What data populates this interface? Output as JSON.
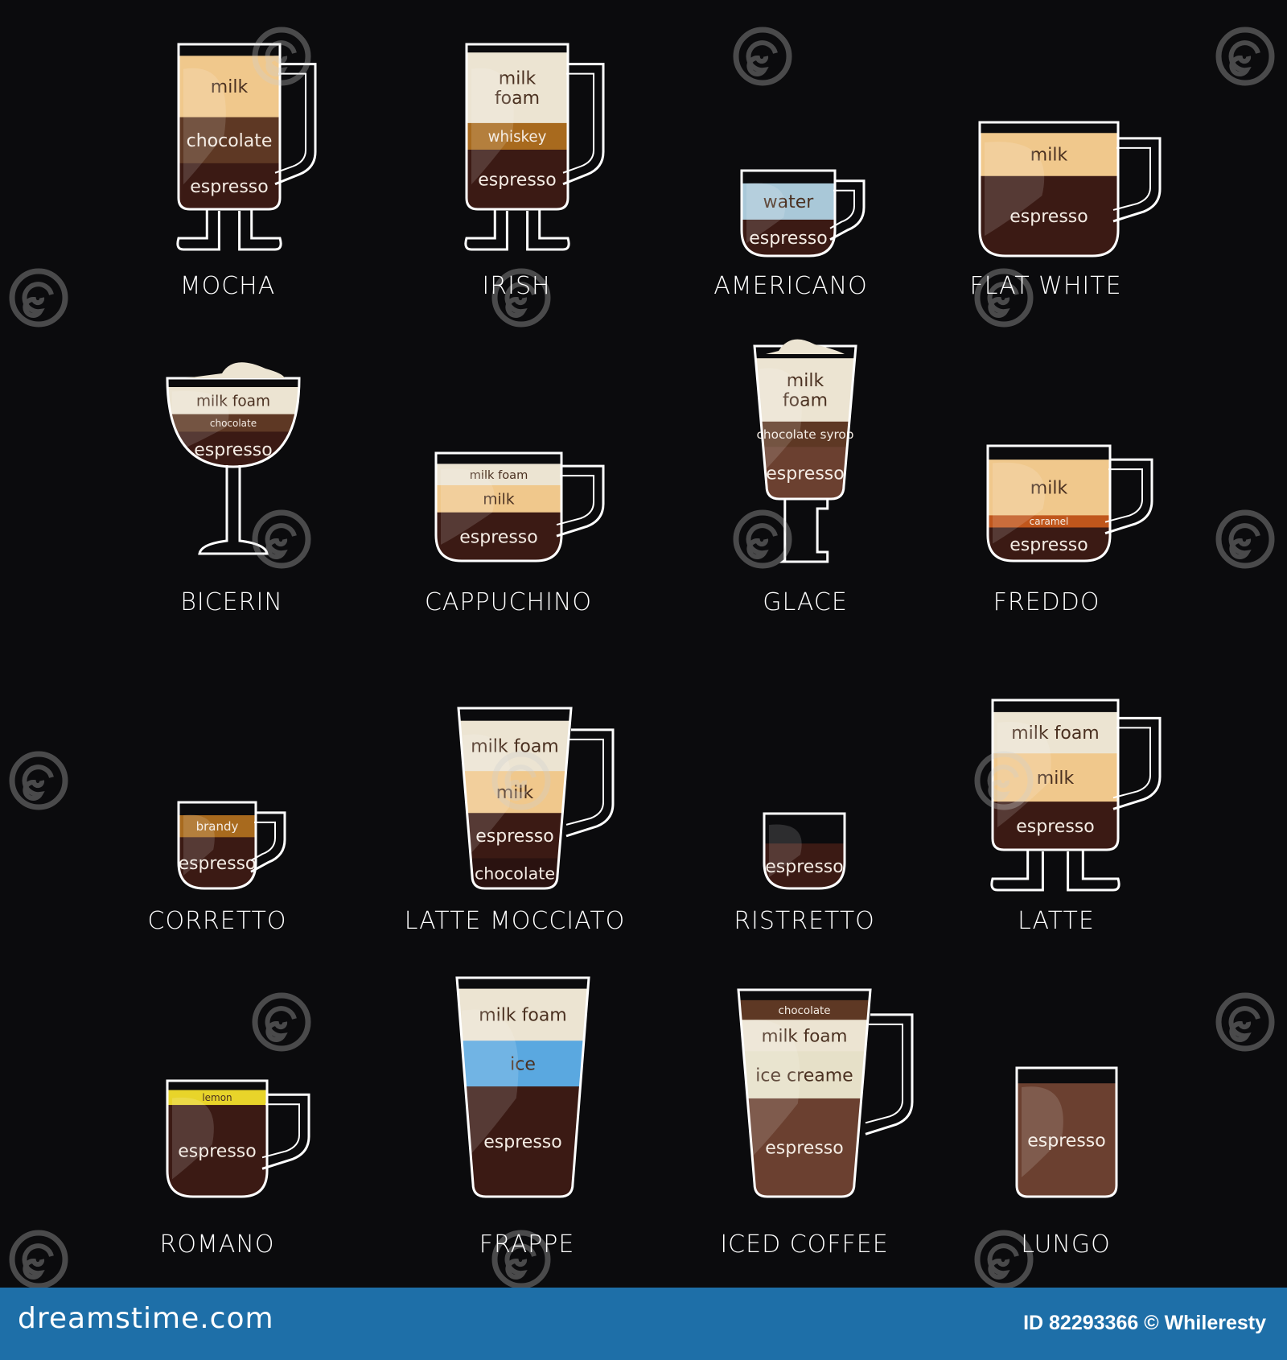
{
  "drinks": [
    {
      "name": "MOCHA",
      "layers": [
        {
          "label": "milk",
          "color": "#f0c88c"
        },
        {
          "label": "chocolate",
          "color": "#5e3824"
        },
        {
          "label": "espresso",
          "color": "#3b1a14"
        }
      ]
    },
    {
      "name": "IRISH",
      "layers": [
        {
          "label": "milk foam",
          "color": "#ece4d2"
        },
        {
          "label": "whiskey",
          "color": "#a86a1e"
        },
        {
          "label": "espresso",
          "color": "#3b1a14"
        }
      ]
    },
    {
      "name": "AMERICANO",
      "layers": [
        {
          "label": "water",
          "color": "#a9c8d8"
        },
        {
          "label": "espresso",
          "color": "#3b1a14"
        }
      ]
    },
    {
      "name": "FLAT WHITE",
      "layers": [
        {
          "label": "milk",
          "color": "#f0c88c"
        },
        {
          "label": "espresso",
          "color": "#3b1a14"
        }
      ]
    },
    {
      "name": "BICERIN",
      "layers": [
        {
          "label": "milk foam",
          "color": "#ece4d2"
        },
        {
          "label": "chocolate",
          "color": "#5e3824"
        },
        {
          "label": "espresso",
          "color": "#3b1a14"
        }
      ]
    },
    {
      "name": "CAPPUCHINO",
      "layers": [
        {
          "label": "milk foam",
          "color": "#ece4d2"
        },
        {
          "label": "milk",
          "color": "#f0c88c"
        },
        {
          "label": "espresso",
          "color": "#3b1a14"
        }
      ]
    },
    {
      "name": "GLACE",
      "layers": [
        {
          "label": "milk foam",
          "color": "#ece4d2"
        },
        {
          "label": "chocolate syrop",
          "color": "#5e3824"
        },
        {
          "label": "espresso",
          "color": "#6b4030"
        }
      ]
    },
    {
      "name": "FREDDO",
      "layers": [
        {
          "label": "milk",
          "color": "#f0c88c"
        },
        {
          "label": "caramel",
          "color": "#c0561c"
        },
        {
          "label": "espresso",
          "color": "#3b1a14"
        }
      ]
    },
    {
      "name": "CORRETTO",
      "layers": [
        {
          "label": "brandy",
          "color": "#a86a1e"
        },
        {
          "label": "espresso",
          "color": "#3b1a14"
        }
      ]
    },
    {
      "name": "LATTE MOCCIATO",
      "layers": [
        {
          "label": "milk foam",
          "color": "#ece4d2"
        },
        {
          "label": "milk",
          "color": "#f0c88c"
        },
        {
          "label": "espresso",
          "color": "#3b1a14"
        },
        {
          "label": "chocolate",
          "color": "#2a1210"
        }
      ]
    },
    {
      "name": "RISTRETTO",
      "layers": [
        {
          "label": "espresso",
          "color": "#3b1a14"
        }
      ]
    },
    {
      "name": "LATTE",
      "layers": [
        {
          "label": "milk foam",
          "color": "#ece4d2"
        },
        {
          "label": "milk",
          "color": "#f0c88c"
        },
        {
          "label": "espresso",
          "color": "#3b1a14"
        }
      ]
    },
    {
      "name": "ROMANO",
      "layers": [
        {
          "label": "lemon",
          "color": "#e8d42a"
        },
        {
          "label": "espresso",
          "color": "#3b1a14"
        }
      ]
    },
    {
      "name": "FRAPPE",
      "layers": [
        {
          "label": "milk foam",
          "color": "#ece4d2"
        },
        {
          "label": "ice",
          "color": "#5aa8e0"
        },
        {
          "label": "espresso",
          "color": "#3b1a14"
        }
      ]
    },
    {
      "name": "ICED COFFEE",
      "layers": [
        {
          "label": "chocolate",
          "color": "#5e3824"
        },
        {
          "label": "milk foam",
          "color": "#ece4d2"
        },
        {
          "label": "ice creame",
          "color": "#e6e0c8"
        },
        {
          "label": "espresso",
          "color": "#6b4030"
        }
      ]
    },
    {
      "name": "LUNGO",
      "layers": [
        {
          "label": "espresso",
          "color": "#6b4030"
        }
      ]
    }
  ],
  "watermark": {
    "text": "dreamstime"
  },
  "footer": {
    "brand": "dreamstime.com",
    "credit": "ID 82293366 © Whileresty"
  },
  "colors": {
    "background": "#0b0b0d",
    "outline": "#ffffff",
    "footer": "#1e6fa8"
  }
}
